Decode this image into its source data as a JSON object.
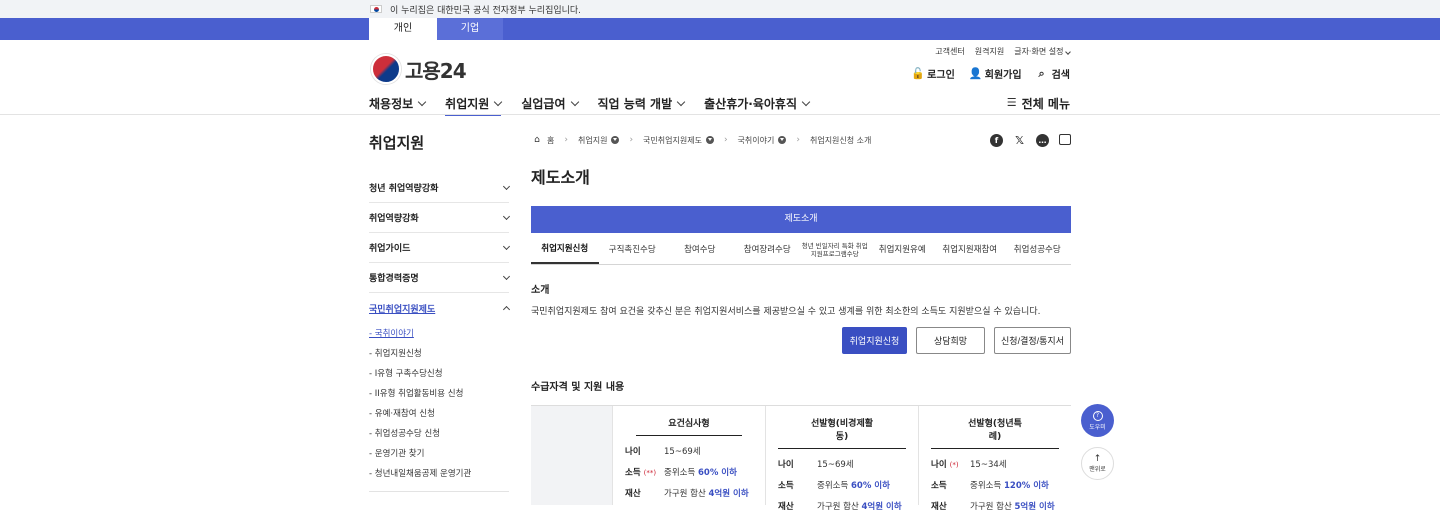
{
  "gov_banner": {
    "text": "이 누리집은 대한민국 공식 전자정부 누리집입니다."
  },
  "audience_tabs": {
    "personal": "개인",
    "company": "기업"
  },
  "utility": {
    "customer_center": "고객센터",
    "remote_support": "원격지원",
    "display_settings": "글자·화면 설정"
  },
  "logo": {
    "text": "고용24"
  },
  "user_actions": {
    "login": "로그인",
    "signup": "회원가입",
    "search": "검색"
  },
  "gnb": {
    "items": [
      "채용정보",
      "취업지원",
      "실업급여",
      "직업 능력 개발",
      "출산휴가·육아휴직"
    ],
    "all_menu": "전체 메뉴"
  },
  "lnb": {
    "title": "취업지원",
    "items": [
      "청년 취업역량강화",
      "취업역량강화",
      "취업가이드",
      "통합경력증명",
      "국민취업지원제도"
    ],
    "sub_items": [
      "- 국취이야기",
      "- 취업지원신청",
      "- I유형 구촉수당신청",
      "- II유형 취업활동비용 신청",
      "- 유예·재참여 신청",
      "- 취업성공수당 신청",
      "- 운영기관 찾기",
      "- 청년내일채움공제 운영기관"
    ]
  },
  "breadcrumb": [
    "홈",
    "취업지원",
    "국민취업지원제도",
    "국취이야기",
    "취업지원신청 소개"
  ],
  "page_title": "제도소개",
  "section_bar": "제도소개",
  "subtabs": [
    "취업지원신청",
    "구직촉진수당",
    "참여수당",
    "참여장려수당",
    "청년 빈일자리 특화 취업지원프로그램수당",
    "취업지원유예",
    "취업지원재참여",
    "취업성공수당"
  ],
  "intro": {
    "heading": "소개",
    "text": "국민취업지원제도 참여 요건을 갖추신 분은 취업지원서비스를 제공받으실 수 있고 생계를 위한 최소한의 소득도 지원받으실 수 있습니다."
  },
  "buttons": {
    "apply": "취업지원신청",
    "consult": "상담희망",
    "notice": "신청/결정/통지서"
  },
  "requirements": {
    "heading": "수급자격 및 지원 내용",
    "columns": [
      {
        "title": "요건심사형",
        "age_label": "나이",
        "age": "15~69세",
        "income_label": "소득",
        "income_mark": "(**)",
        "income_prefix": "중위소득 ",
        "income_value": "60% 이하",
        "asset_label": "재산",
        "asset_prefix": "가구원 합산 ",
        "asset_value": "4억원 이하"
      },
      {
        "title": "선발형(비경제활동)",
        "age_label": "나이",
        "age": "15~69세",
        "income_label": "소득",
        "income_prefix": "중위소득 ",
        "income_value": "60% 이하",
        "asset_label": "재산",
        "asset_prefix": "가구원 합산 ",
        "asset_value": "4억원 이하"
      },
      {
        "title": "선발형(청년특례)",
        "age_label": "나이",
        "age_mark": "(*)",
        "age": "15~34세",
        "income_label": "소득",
        "income_prefix": "중위소득 ",
        "income_value": "120% 이하",
        "asset_label": "재산",
        "asset_prefix": "가구원 합산 ",
        "asset_value": "5억원 이하"
      }
    ]
  },
  "floating": {
    "help": "도우미",
    "top": "맨위로"
  }
}
